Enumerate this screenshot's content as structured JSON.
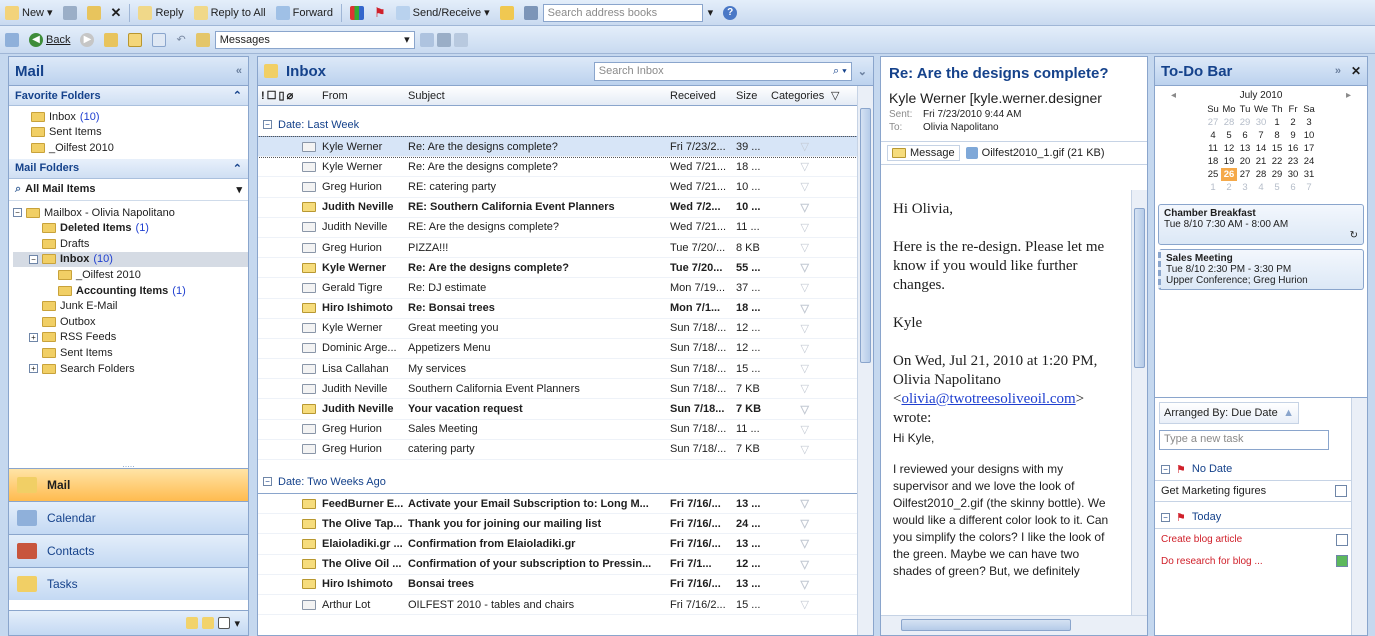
{
  "toolbar1": {
    "new": "New",
    "reply": "Reply",
    "reply_all": "Reply to All",
    "forward": "Forward",
    "send_receive": "Send/Receive",
    "address_search": "Search address books"
  },
  "toolbar2": {
    "back": "Back",
    "view_combo": "Messages"
  },
  "nav": {
    "title": "Mail",
    "favorites_header": "Favorite Folders",
    "favorites": [
      {
        "label": "Inbox",
        "count": "(10)"
      },
      {
        "label": "Sent Items",
        "count": ""
      },
      {
        "label": "_Oilfest 2010",
        "count": ""
      }
    ],
    "mail_folders_header": "Mail Folders",
    "all_items": "All Mail Items",
    "tree": [
      {
        "label": "Mailbox - Olivia Napolitano",
        "count": "",
        "level": 0,
        "bold": false
      },
      {
        "label": "Deleted Items",
        "count": "(1)",
        "level": 1,
        "bold": true
      },
      {
        "label": "Drafts",
        "count": "",
        "level": 1,
        "bold": false
      },
      {
        "label": "Inbox",
        "count": "(10)",
        "level": 1,
        "bold": true
      },
      {
        "label": "_Oilfest 2010",
        "count": "",
        "level": 2,
        "bold": false
      },
      {
        "label": "Accounting Items",
        "count": "(1)",
        "level": 2,
        "bold": true
      },
      {
        "label": "Junk E-Mail",
        "count": "",
        "level": 1,
        "bold": false
      },
      {
        "label": "Outbox",
        "count": "",
        "level": 1,
        "bold": false
      },
      {
        "label": "RSS Feeds",
        "count": "",
        "level": 1,
        "bold": false
      },
      {
        "label": "Sent Items",
        "count": "",
        "level": 1,
        "bold": false
      },
      {
        "label": "Search Folders",
        "count": "",
        "level": 1,
        "bold": false
      }
    ],
    "buttons": [
      "Mail",
      "Calendar",
      "Contacts",
      "Tasks"
    ]
  },
  "inbox": {
    "title": "Inbox",
    "search_placeholder": "Search Inbox",
    "columns": {
      "from": "From",
      "subject": "Subject",
      "received": "Received",
      "size": "Size",
      "categories": "Categories"
    },
    "group1": "Date: Last Week",
    "group2": "Date: Two Weeks Ago",
    "rows1": [
      {
        "from": "Kyle Werner",
        "subject": "Re: Are the designs complete?",
        "received": "Fri 7/23/2...",
        "size": "39 ...",
        "unread": false,
        "sel": true
      },
      {
        "from": "Kyle Werner",
        "subject": "Re: Are the designs complete?",
        "received": "Wed 7/21...",
        "size": "18 ...",
        "unread": false,
        "sel": false
      },
      {
        "from": "Greg Hurion",
        "subject": "RE: catering party",
        "received": "Wed 7/21...",
        "size": "10 ...",
        "unread": false,
        "sel": false
      },
      {
        "from": "Judith Neville",
        "subject": "RE: Southern California Event Planners",
        "received": "Wed 7/2...",
        "size": "10 ...",
        "unread": true,
        "sel": false
      },
      {
        "from": "Judith Neville",
        "subject": "RE: Are the designs complete?",
        "received": "Wed 7/21...",
        "size": "11 ...",
        "unread": false,
        "sel": false
      },
      {
        "from": "Greg Hurion",
        "subject": "PIZZA!!!",
        "received": "Tue 7/20/...",
        "size": "8 KB",
        "unread": false,
        "sel": false
      },
      {
        "from": "Kyle Werner",
        "subject": "Re: Are the designs complete?",
        "received": "Tue 7/20...",
        "size": "55 ...",
        "unread": true,
        "sel": false
      },
      {
        "from": "Gerald Tigre",
        "subject": "Re: DJ estimate",
        "received": "Mon 7/19...",
        "size": "37 ...",
        "unread": false,
        "sel": false
      },
      {
        "from": "Hiro Ishimoto",
        "subject": "Re: Bonsai trees",
        "received": "Mon 7/1...",
        "size": "18 ...",
        "unread": true,
        "sel": false
      },
      {
        "from": "Kyle Werner",
        "subject": "Great meeting you",
        "received": "Sun 7/18/...",
        "size": "12 ...",
        "unread": false,
        "sel": false
      },
      {
        "from": "Dominic Arge...",
        "subject": "Appetizers Menu",
        "received": "Sun 7/18/...",
        "size": "12 ...",
        "unread": false,
        "sel": false
      },
      {
        "from": "Lisa Callahan",
        "subject": "My services",
        "received": "Sun 7/18/...",
        "size": "15 ...",
        "unread": false,
        "sel": false
      },
      {
        "from": "Judith Neville",
        "subject": "Southern California Event Planners",
        "received": "Sun 7/18/...",
        "size": "7 KB",
        "unread": false,
        "sel": false
      },
      {
        "from": "Judith Neville",
        "subject": "Your vacation request",
        "received": "Sun 7/18...",
        "size": "7 KB",
        "unread": true,
        "sel": false
      },
      {
        "from": "Greg Hurion",
        "subject": "Sales Meeting",
        "received": "Sun 7/18/...",
        "size": "11 ...",
        "unread": false,
        "sel": false
      },
      {
        "from": "Greg Hurion",
        "subject": "catering party",
        "received": "Sun 7/18/...",
        "size": "7 KB",
        "unread": false,
        "sel": false
      }
    ],
    "rows2": [
      {
        "from": "FeedBurner E...",
        "subject": "Activate your Email Subscription to: Long M...",
        "received": "Fri 7/16/...",
        "size": "13 ...",
        "unread": true
      },
      {
        "from": "The Olive Tap...",
        "subject": "Thank you for joining our mailing list",
        "received": "Fri 7/16/...",
        "size": "24 ...",
        "unread": true
      },
      {
        "from": "Elaioladiki.gr ...",
        "subject": "Confirmation from Elaioladiki.gr",
        "received": "Fri 7/16/...",
        "size": "13 ...",
        "unread": true
      },
      {
        "from": "The Olive Oil ...",
        "subject": "Confirmation of your subscription to Pressin...",
        "received": "Fri 7/1...",
        "size": "12 ...",
        "unread": true
      },
      {
        "from": "Hiro Ishimoto",
        "subject": "Bonsai trees",
        "received": "Fri 7/16/...",
        "size": "13 ...",
        "unread": true
      },
      {
        "from": "Arthur Lot",
        "subject": "OILFEST 2010 - tables and chairs",
        "received": "Fri 7/16/2...",
        "size": "15 ...",
        "unread": false
      }
    ]
  },
  "reading": {
    "subject": "Re: Are the designs complete?",
    "from": "Kyle Werner [kyle.werner.designer",
    "sent_label": "Sent:",
    "sent": "Fri 7/23/2010 9:44 AM",
    "to_label": "To:",
    "to": "Olivia Napolitano",
    "tab_message": "Message",
    "tab_attachment": "Oilfest2010_1.gif (21 KB)",
    "greeting": "Hi Olivia,",
    "para1": "Here is the re-design. Please let me know if you would like further changes.",
    "sig": "Kyle",
    "quote_intro": "On Wed, Jul 21, 2010 at 1:20 PM, Olivia Napolitano",
    "quote_email": "olivia@twotreesoliveoil.com",
    "quote_wrote": "wrote:",
    "quote_hi": "Hi Kyle,",
    "quote_body": "I reviewed your designs with my supervisor and we love the look of Oilfest2010_2.gif (the skinny bottle). We would like a different color look to it. Can you simplify the colors? I like the look of the green. Maybe we can have two shades of green? But, we definitely"
  },
  "todo": {
    "title": "To-Do Bar",
    "month": "July 2010",
    "weekdays": [
      "Su",
      "Mo",
      "Tu",
      "We",
      "Th",
      "Fr",
      "Sa"
    ],
    "weeks": [
      [
        "27",
        "28",
        "29",
        "30",
        "1",
        "2",
        "3"
      ],
      [
        "4",
        "5",
        "6",
        "7",
        "8",
        "9",
        "10"
      ],
      [
        "11",
        "12",
        "13",
        "14",
        "15",
        "16",
        "17"
      ],
      [
        "18",
        "19",
        "20",
        "21",
        "22",
        "23",
        "24"
      ],
      [
        "25",
        "26",
        "27",
        "28",
        "29",
        "30",
        "31"
      ],
      [
        "1",
        "2",
        "3",
        "4",
        "5",
        "6",
        "7"
      ]
    ],
    "appt1_title": "Chamber Breakfast",
    "appt1_time": "Tue 8/10 7:30 AM - 8:00 AM",
    "appt2_title": "Sales Meeting",
    "appt2_time": "Tue 8/10 2:30 PM - 3:30 PM",
    "appt2_loc": "Upper Conference; Greg Hurion",
    "arranged_by": "Arranged By: Due Date",
    "new_task_placeholder": "Type a new task",
    "group_nodate": "No Date",
    "task1": "Get Marketing figures",
    "group_today": "Today",
    "task2": "Create blog article",
    "task3": "Do research for blog ..."
  },
  "colors": {
    "accent": "#15428b",
    "flag": "#d0202a",
    "today": "#f5a949",
    "nav_active": "#ffbb4f"
  }
}
